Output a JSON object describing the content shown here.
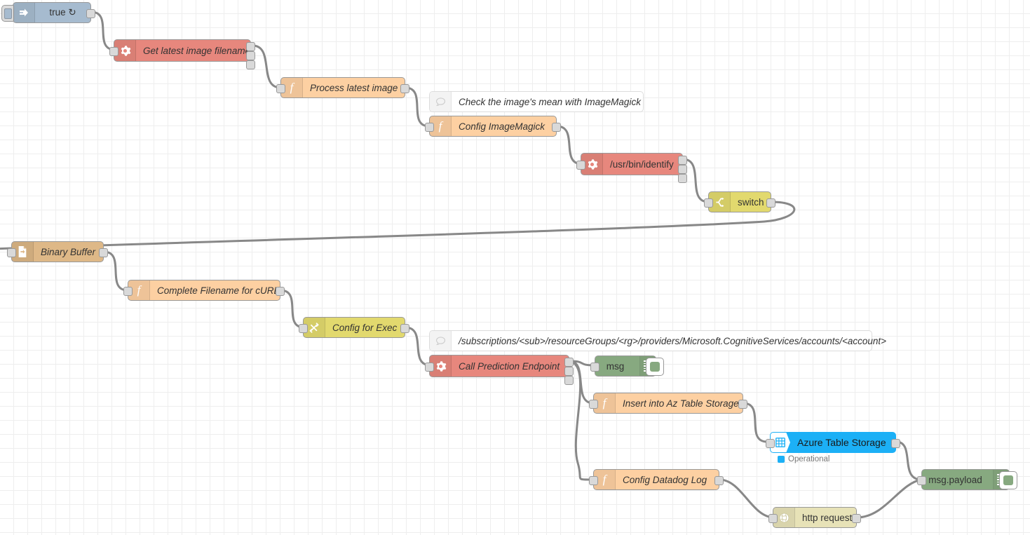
{
  "editor": {
    "name": "node-red-flow-canvas",
    "grid_size_px": 20,
    "canvas_bg": "#ffffff",
    "grid_color": "#eeeeee",
    "wire_color": "#888888"
  },
  "palette": {
    "inject": "#a6bbcf",
    "exec": "#e7877d",
    "function": "#fdd0a2",
    "switch": "#e2d96e",
    "change": "#e2d96e",
    "file_in": "#deb887",
    "debug": "#87a980",
    "http_request": "#e7e2b7",
    "azure": "#1cb0f6",
    "comment_bg": "#ffffff",
    "status_operational": "#1cb0f6"
  },
  "nodes": [
    {
      "id": "inject-true",
      "label": "true ↻",
      "icon": "inject-arrow-icon"
    },
    {
      "id": "exec-get-latest",
      "label": "Get latest image filename",
      "icon": "gear-icon"
    },
    {
      "id": "fn-process-latest",
      "label": "Process latest image",
      "icon": "function-f-icon"
    },
    {
      "id": "comment-imagemagick",
      "label": "Check the image's mean with ImageMagick",
      "icon": "comment-bubble-icon"
    },
    {
      "id": "fn-config-im",
      "label": "Config ImageMagick",
      "icon": "function-f-icon"
    },
    {
      "id": "exec-identify",
      "label": "/usr/bin/identify",
      "icon": "gear-icon"
    },
    {
      "id": "switch-node",
      "label": "switch",
      "icon": "switch-icon"
    },
    {
      "id": "file-binary-buffer",
      "label": "Binary Buffer",
      "icon": "file-icon"
    },
    {
      "id": "fn-complete-curl",
      "label": "Complete Filename for cURL",
      "icon": "function-f-icon"
    },
    {
      "id": "change-config-exec",
      "label": "Config for Exec",
      "icon": "change-swap-icon"
    },
    {
      "id": "comment-subscription",
      "label": "/subscriptions/<sub>/resourceGroups/<rg>/providers/Microsoft.CognitiveServices/accounts/<account>",
      "icon": "comment-bubble-icon"
    },
    {
      "id": "exec-call-pred",
      "label": "Call Prediction Endpoint",
      "icon": "gear-icon"
    },
    {
      "id": "debug-msg",
      "label": "msg",
      "icon": "debug-lines-icon"
    },
    {
      "id": "fn-insert-az",
      "label": "Insert into Az Table Storage",
      "icon": "function-f-icon"
    },
    {
      "id": "azure-table",
      "label": "Azure Table Storage",
      "icon": "table-grid-icon",
      "status": "Operational"
    },
    {
      "id": "fn-config-datadog",
      "label": "Config Datadog Log",
      "icon": "function-f-icon"
    },
    {
      "id": "http-request",
      "label": "http request",
      "icon": "globe-icon"
    },
    {
      "id": "debug-msg-payload",
      "label": "msg.payload",
      "icon": "debug-lines-icon"
    }
  ]
}
